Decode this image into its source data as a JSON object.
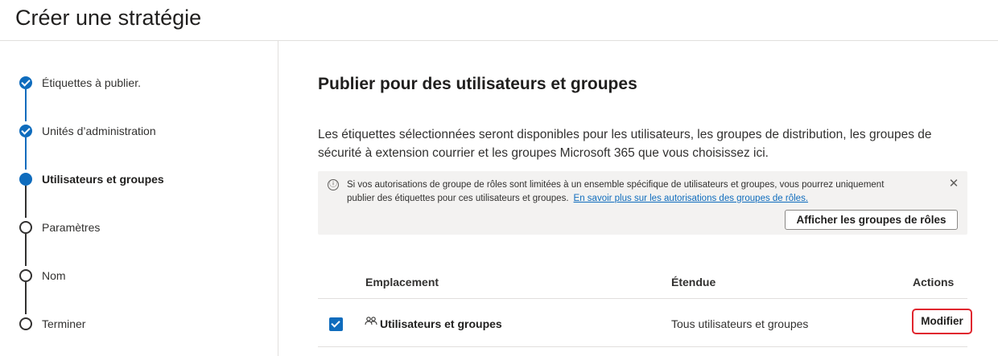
{
  "page": {
    "title": "Créer une stratégie"
  },
  "steps": [
    {
      "label": "Étiquettes à publier.",
      "state": "done"
    },
    {
      "label": "Unités d’administration",
      "state": "done"
    },
    {
      "label": "Utilisateurs et groupes",
      "state": "current"
    },
    {
      "label": "Paramètres",
      "state": "todo"
    },
    {
      "label": "Nom",
      "state": "todo"
    },
    {
      "label": "Terminer",
      "state": "todo"
    }
  ],
  "main": {
    "title": "Publier pour des utilisateurs et groupes",
    "description": "Les étiquettes sélectionnées seront disponibles pour les utilisateurs, les groupes de distribution, les groupes de sécurité à extension courrier et les groupes Microsoft 365 que vous choisissez ici."
  },
  "info": {
    "text": "Si vos autorisations de groupe de rôles sont limitées à un ensemble spécifique de utilisateurs et groupes, vous pourrez uniquement publier des étiquettes pour ces utilisateurs et groupes.",
    "link": "En savoir plus sur les autorisations des groupes de rôles.",
    "button": "Afficher les groupes de rôles",
    "info_icon": "ⓘ",
    "close_icon": "✕"
  },
  "table": {
    "headers": {
      "location": "Emplacement",
      "scope": "Étendue",
      "actions": "Actions"
    },
    "rows": [
      {
        "checked": true,
        "name": "Utilisateurs et groupes",
        "scope": "Tous utilisateurs et groupes",
        "action": "Modifier"
      }
    ]
  },
  "colors": {
    "accent": "#0f6cbd",
    "highlight": "#e0262e"
  }
}
